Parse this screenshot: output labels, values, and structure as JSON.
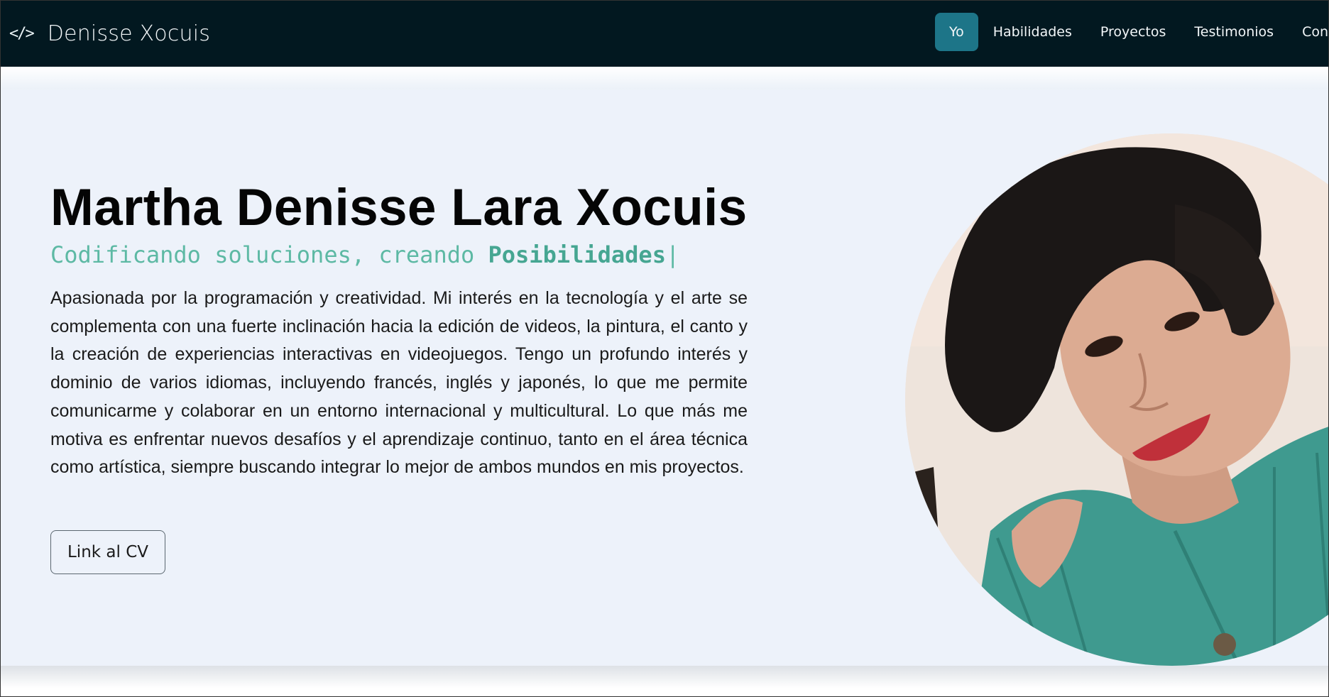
{
  "navbar": {
    "brand_icon": "</>",
    "brand_name": "Denisse Xocuis",
    "links": [
      {
        "label": "Yo",
        "active": true
      },
      {
        "label": "Habilidades",
        "active": false
      },
      {
        "label": "Proyectos",
        "active": false
      },
      {
        "label": "Testimonios",
        "active": false
      },
      {
        "label": "Contacto",
        "active": false
      }
    ]
  },
  "hero": {
    "title": "Martha Denisse Lara Xocuis",
    "subtitle_prefix": "Codificando soluciones, creando ",
    "subtitle_accent": "Posibilidades",
    "subtitle_cursor": "|",
    "description": "Apasionada por la programación y creatividad. Mi interés en la tecnología y el arte se complementa con una fuerte inclinación hacia la edición de videos, la pintura, el canto y la creación de experiencias interactivas en videojuegos. Tengo un profundo interés y dominio de varios idiomas, incluyendo francés, inglés y japonés, lo que me permite comunicarme y colaborar en un entorno internacional y multicultural. Lo que más me motiva es enfrentar nuevos desafíos y el aprendizaje continuo, tanto en el área técnica como artística, siempre buscando integrar lo mejor de ambos mundos en mis proyectos.",
    "cv_button": "Link al CV",
    "portrait_icon": "profile-photo"
  },
  "colors": {
    "navbar_bg": "#021820",
    "active_tab": "#1d7588",
    "hero_bg": "#edf2fa",
    "accent": "#5db9a4"
  }
}
